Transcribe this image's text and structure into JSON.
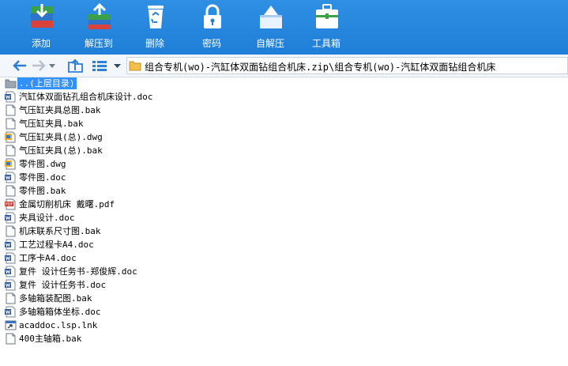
{
  "toolbar": {
    "buttons": [
      {
        "label": "添加",
        "icon": "add-archive-icon"
      },
      {
        "label": "解压到",
        "icon": "extract-to-icon"
      },
      {
        "label": "删除",
        "icon": "delete-recycle-icon"
      },
      {
        "label": "密码",
        "icon": "password-lock-icon"
      },
      {
        "label": "自解压",
        "icon": "self-extract-icon"
      },
      {
        "label": "工具箱",
        "icon": "toolbox-icon"
      }
    ],
    "accent_color": "#1f7fd8"
  },
  "navbar": {
    "path": "组合专机(wo)-汽缸体双面钻组合机床.zip\\组合专机(wo)-汽缸体双面钻组合机床"
  },
  "files": [
    {
      "name": "..(上层目录)",
      "type": "parent-folder",
      "selected": true
    },
    {
      "name": "汽缸体双面钻孔组合机床设计.doc",
      "type": "doc"
    },
    {
      "name": "气压缸夹具总图.bak",
      "type": "bak"
    },
    {
      "name": "气压缸夹具.bak",
      "type": "bak"
    },
    {
      "name": "气压缸夹具(总).dwg",
      "type": "dwg"
    },
    {
      "name": "气压缸夹具(总).bak",
      "type": "bak"
    },
    {
      "name": "零件图.dwg",
      "type": "dwg"
    },
    {
      "name": "零件图.doc",
      "type": "doc"
    },
    {
      "name": "零件图.bak",
      "type": "bak"
    },
    {
      "name": "金属切削机床 戴曙.pdf",
      "type": "pdf"
    },
    {
      "name": "夹具设计.doc",
      "type": "doc"
    },
    {
      "name": "机床联系尺寸图.bak",
      "type": "bak"
    },
    {
      "name": "工艺过程卡A4.doc",
      "type": "doc"
    },
    {
      "name": "工序卡A4.doc",
      "type": "doc"
    },
    {
      "name": "复件 设计任务书-郑俊辉.doc",
      "type": "doc"
    },
    {
      "name": "复件 设计任务书.doc",
      "type": "doc"
    },
    {
      "name": "多轴箱装配图.bak",
      "type": "bak"
    },
    {
      "name": "多轴箱箱体坐标.doc",
      "type": "doc"
    },
    {
      "name": "acaddoc.lsp.lnk",
      "type": "lnk"
    },
    {
      "name": "400主轴箱.bak",
      "type": "bak"
    }
  ]
}
